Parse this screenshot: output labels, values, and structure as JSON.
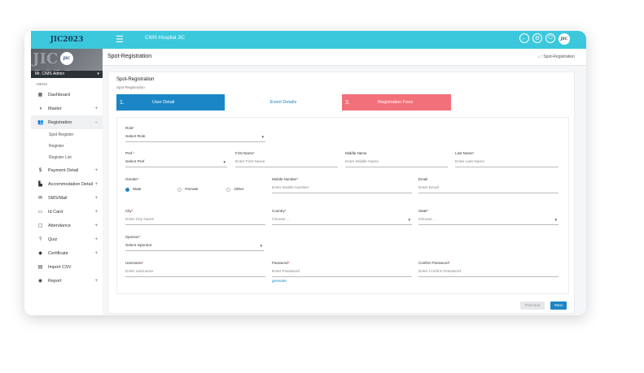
{
  "topbar": {
    "logo": "JIC2023",
    "title": "CIMS Hospital JIC",
    "icons": [
      "back-icon",
      "settings-icon",
      "power-icon"
    ],
    "avatar": "JIC"
  },
  "sidebar": {
    "banner_logo": "JIC",
    "banner_bg_text": "JIC 2023",
    "user": "Mr. CIMS Admin",
    "menu_label": "MENU",
    "items": [
      {
        "label": "Dashboard",
        "icon": "dashboard-icon",
        "glyph": "▦",
        "plus": ""
      },
      {
        "label": "Master",
        "icon": "master-icon",
        "glyph": "◑",
        "plus": "+"
      },
      {
        "label": "Registration",
        "icon": "users-icon",
        "glyph": "👥",
        "plus": "–"
      },
      {
        "label": "Payment Detail",
        "icon": "dollar-icon",
        "glyph": "$",
        "plus": "+"
      },
      {
        "label": "Accommodation Detail",
        "icon": "building-icon",
        "glyph": "▙",
        "plus": "+"
      },
      {
        "label": "SMS/Mail",
        "icon": "mail-icon",
        "glyph": "✉",
        "plus": "+"
      },
      {
        "label": "Id Card",
        "icon": "id-card-icon",
        "glyph": "▭",
        "plus": "+"
      },
      {
        "label": "Attendance",
        "icon": "monitor-icon",
        "glyph": "▢",
        "plus": "+"
      },
      {
        "label": "Quiz",
        "icon": "question-icon",
        "glyph": "?",
        "plus": "+"
      },
      {
        "label": "Certificate",
        "icon": "tag-icon",
        "glyph": "◆",
        "plus": "+"
      },
      {
        "label": "Import CSV",
        "icon": "file-icon",
        "glyph": "▤",
        "plus": ""
      },
      {
        "label": "Report",
        "icon": "globe-icon",
        "glyph": "◉",
        "plus": "+"
      }
    ],
    "sub_items": [
      "Spot Register",
      "Register",
      "Register List"
    ]
  },
  "page": {
    "title": "Spot-Registration",
    "breadcrumb": "Spot-Registration",
    "panel_title": "Spot-Registration",
    "panel_sub": "Spot-Registration"
  },
  "steps": [
    {
      "num": "1.",
      "label": "User Detail"
    },
    {
      "num": "",
      "label": "Event Details"
    },
    {
      "num": "3.",
      "label": "Registration Fees"
    }
  ],
  "form": {
    "role": {
      "label": "Role",
      "value": "Select Role"
    },
    "pref": {
      "label": "Pref.",
      "value": "Select Pref"
    },
    "first_name": {
      "label": "First Name",
      "placeholder": "Enter First Name"
    },
    "middle_name": {
      "label": "Middle Name",
      "placeholder": "Enter Middle Name"
    },
    "last_name": {
      "label": "Last Name",
      "placeholder": "Enter Last Name"
    },
    "gender": {
      "label": "Gender",
      "options": [
        "Male",
        "Female",
        "Other"
      ],
      "selected": "Male"
    },
    "mobile": {
      "label": "Mobile Number",
      "placeholder": "Enter Mobile Number"
    },
    "email": {
      "label": "Email",
      "placeholder": "Enter Email"
    },
    "city": {
      "label": "City",
      "placeholder": "Enter City Name"
    },
    "country": {
      "label": "Country",
      "value": "Choose ..."
    },
    "state": {
      "label": "State",
      "value": "Choose ..."
    },
    "sponsor": {
      "label": "Sponsor",
      "value": "Select Sponsor"
    },
    "username": {
      "label": "Username",
      "placeholder": "Enter username"
    },
    "password": {
      "label": "Password",
      "placeholder": "Enter Password",
      "link": "generate"
    },
    "confirm_password": {
      "label": "Confirm Password",
      "placeholder": "Enter Confirm Password"
    }
  },
  "buttons": {
    "previous": "Previous",
    "next": "Next"
  },
  "colors": {
    "topbar": "#3cc8dc",
    "primary": "#1b86c6",
    "step3": "#f2707a"
  }
}
